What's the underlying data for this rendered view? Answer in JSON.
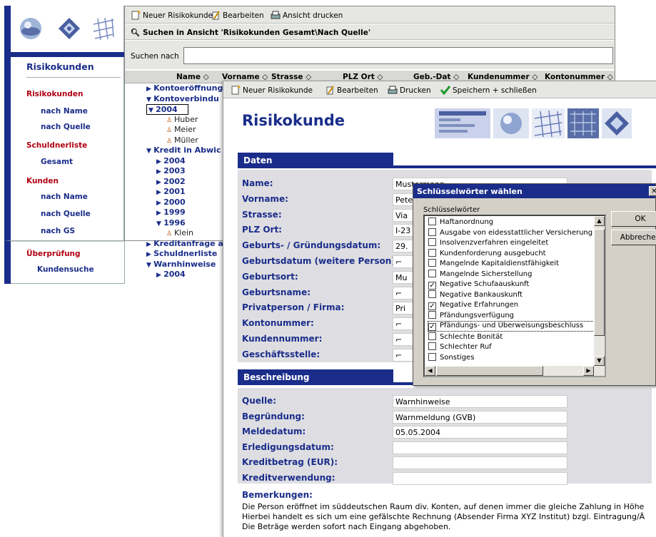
{
  "nav": {
    "title": "Risikokunden",
    "items": [
      {
        "label": "Risikokunden",
        "kind": "h"
      },
      {
        "label": "nach Name",
        "kind": "s"
      },
      {
        "label": "nach Quelle",
        "kind": "s"
      },
      {
        "label": "Schuldnerliste",
        "kind": "h"
      },
      {
        "label": "Gesamt",
        "kind": "s"
      },
      {
        "label": "Kunden",
        "kind": "h"
      },
      {
        "label": "nach Name",
        "kind": "s"
      },
      {
        "label": "nach Quelle",
        "kind": "s"
      },
      {
        "label": "nach GS",
        "kind": "s"
      },
      {
        "label": "Überprüfung",
        "kind": "h"
      },
      {
        "label": "Kundensuche",
        "kind": "s"
      }
    ]
  },
  "view": {
    "toolbar": {
      "new": "Neuer Risikokunde",
      "edit": "Bearbeiten",
      "print": "Ansicht drucken"
    },
    "search_title": "Suchen in Ansicht 'Risikokunden Gesamt\\Nach Quelle'",
    "search_label": "Suchen nach",
    "search_value": "",
    "columns": [
      "Name ◇",
      "Vorname ◇",
      "Strasse ◇",
      "PLZ Ort ◇",
      "Geb.-Dat ◇",
      "Kundenummer ◇",
      "Kontonummer ◇"
    ],
    "tree": [
      {
        "label": "Kontoeröffnung",
        "icon": "▶",
        "level": 0
      },
      {
        "label": "Kontoverbindu",
        "icon": "▼",
        "level": 0
      },
      {
        "label": "2004",
        "icon": "▼",
        "level": 1
      },
      {
        "label": "Huber",
        "icon": "♙",
        "level": 2
      },
      {
        "label": "Meier",
        "icon": "♙",
        "level": 2
      },
      {
        "label": "Müller",
        "icon": "♙",
        "level": 2
      },
      {
        "label": "Kredit in Abwic",
        "icon": "▼",
        "level": 0
      },
      {
        "label": "2004",
        "icon": "▶",
        "level": 1
      },
      {
        "label": "2003",
        "icon": "▶",
        "level": 1
      },
      {
        "label": "2002",
        "icon": "▶",
        "level": 1
      },
      {
        "label": "2001",
        "icon": "▶",
        "level": 1
      },
      {
        "label": "2000",
        "icon": "▶",
        "level": 1
      },
      {
        "label": "1999",
        "icon": "▶",
        "level": 1
      },
      {
        "label": "1996",
        "icon": "▼",
        "level": 1
      },
      {
        "label": "Klein",
        "icon": "♙",
        "level": 2
      },
      {
        "label": "Kreditanfrage a",
        "icon": "▶",
        "level": 0
      },
      {
        "label": "Schuldnerliste",
        "icon": "▶",
        "level": 0
      },
      {
        "label": "Warnhinweise",
        "icon": "▼",
        "level": 0
      },
      {
        "label": "2004",
        "icon": "▶",
        "level": 1
      }
    ]
  },
  "form": {
    "toolbar": {
      "new": "Neuer Risikokunde",
      "edit": "Bearbeiten",
      "print": "Drucken",
      "save": "Speichern + schließen"
    },
    "title": "Risikokunde",
    "section_data": "Daten",
    "section_desc": "Beschreibung",
    "fields": [
      {
        "label": "Name:",
        "value": "Mustermann"
      },
      {
        "label": "Vorname:",
        "value": "Peter"
      },
      {
        "label": "Strasse:",
        "value": "Via"
      },
      {
        "label": "PLZ Ort:",
        "value": "I-23"
      },
      {
        "label": "Geburts- / Gründungsdatum:",
        "value": "29."
      },
      {
        "label": "Geburtsdatum (weitere Person):",
        "value": "⌐"
      },
      {
        "label": "Geburtsort:",
        "value": "Mu"
      },
      {
        "label": "Geburtsname:",
        "value": "⌐"
      },
      {
        "label": "Privatperson / Firma:",
        "value": "Pri"
      },
      {
        "label": "Kontonummer:",
        "value": "⌐"
      },
      {
        "label": "Kundennummer:",
        "value": "⌐"
      },
      {
        "label": "Geschäftsstelle:",
        "value": "⌐"
      }
    ],
    "desc_fields": [
      {
        "label": "Quelle:",
        "value": "Warnhinweise"
      },
      {
        "label": "Begründung:",
        "value": "Warnmeldung (GVB)"
      },
      {
        "label": "Meldedatum:",
        "value": "05.05.2004"
      },
      {
        "label": "Erledigungsdatum:",
        "value": ""
      },
      {
        "label": "Kreditbetrag (EUR):",
        "value": ""
      },
      {
        "label": "Kreditverwendung:",
        "value": ""
      }
    ],
    "notes_label": "Bemerkungen:",
    "notes_lines": [
      "Die Person eröffnet im süddeutschen Raum div. Konten, auf denen immer die gleiche Zahlung in Höhe",
      "Hierbei handelt es sich um eine gefälschte Rechnung (Absender Firma XYZ Institut) bzgl. Eintragung/Ä",
      "Die Beträge werden sofort nach Eingang abgehoben."
    ]
  },
  "dialog": {
    "title": "Schlüsselwörter wählen",
    "list_label": "Schlüsselwörter",
    "ok": "OK",
    "cancel": "Abbrechen",
    "items": [
      {
        "label": "Haftanordnung",
        "checked": false
      },
      {
        "label": "Ausgabe von eidesstattlicher Versicherung",
        "checked": false
      },
      {
        "label": "Insolvenzverfahren eingeleitet",
        "checked": false
      },
      {
        "label": "Kundenforderung ausgebucht",
        "checked": false
      },
      {
        "label": "Mangelnde Kapitaldienstfähigkeit",
        "checked": false
      },
      {
        "label": "Mangelnde Sicherstellung",
        "checked": false
      },
      {
        "label": "Negative Schufaauskunft",
        "checked": true
      },
      {
        "label": "Negative Bankauskunft",
        "checked": false
      },
      {
        "label": "Negative Erfahrungen",
        "checked": true
      },
      {
        "label": "Pfändungsverfügung",
        "checked": false
      },
      {
        "label": "Pfändungs- und Überweisungsbeschluss",
        "checked": true,
        "selected": true
      },
      {
        "label": "Schlechte Bonität",
        "checked": false
      },
      {
        "label": "Schlechter Ruf",
        "checked": false
      },
      {
        "label": "Sonstiges",
        "checked": false
      }
    ]
  },
  "colors": {
    "navy": "#1a2d8a",
    "red": "#b00012",
    "panel": "#e6e6e2"
  }
}
